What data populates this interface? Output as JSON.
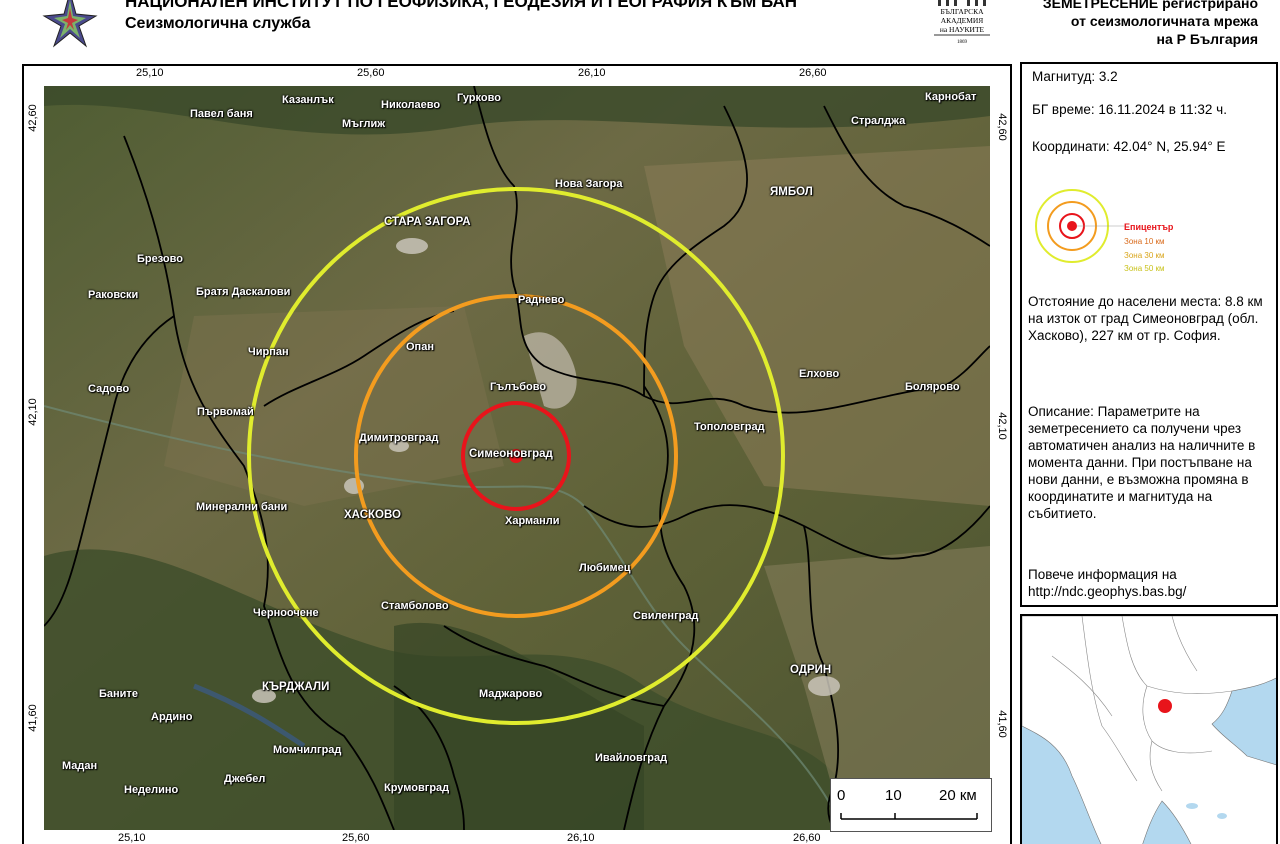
{
  "header": {
    "institute": "НАЦИОНАЛЕН ИНСТИТУТ ПО ГЕОФИЗИКА, ГЕОДЕЗИЯ И ГЕОГРАФИЯ КЪМ БАН",
    "service": "Сеизмологична служба",
    "bas_logo_text": [
      "БЪЛГАРСКА",
      "АКАДЕМИЯ",
      "на НАУКИТЕ",
      "1869"
    ],
    "right_line1": "ЗЕМЕТРЕСЕНИЕ регистрирано",
    "right_line2": "от сеизмологичната мрежа",
    "right_line3": "на Р България"
  },
  "map": {
    "ticks_lon": [
      "25,10",
      "25,60",
      "26,10",
      "26,60"
    ],
    "ticks_lat": [
      "42,60",
      "42,10",
      "41,60"
    ],
    "places": [
      {
        "name": "Казанлък"
      },
      {
        "name": "Николаево"
      },
      {
        "name": "Гурково"
      },
      {
        "name": "Павел баня"
      },
      {
        "name": "Мъглиж"
      },
      {
        "name": "Карнобат"
      },
      {
        "name": "Стралджа"
      },
      {
        "name": "Нова Загора"
      },
      {
        "name": "ЯМБОЛ"
      },
      {
        "name": "СТАРА ЗАГОРА"
      },
      {
        "name": "Брезово"
      },
      {
        "name": "Раковски"
      },
      {
        "name": "Братя Даскалови"
      },
      {
        "name": "Раднево"
      },
      {
        "name": "Опан"
      },
      {
        "name": "Чирпан"
      },
      {
        "name": "Гълъбово"
      },
      {
        "name": "Елхово"
      },
      {
        "name": "Болярово"
      },
      {
        "name": "Садово"
      },
      {
        "name": "Първомай"
      },
      {
        "name": "Тополовград"
      },
      {
        "name": "Димитровград"
      },
      {
        "name": "Симеоновград"
      },
      {
        "name": "Минерални бани"
      },
      {
        "name": "ХАСКОВО"
      },
      {
        "name": "Харманли"
      },
      {
        "name": "Любимец"
      },
      {
        "name": "Черноочене"
      },
      {
        "name": "Стамболово"
      },
      {
        "name": "Свиленград"
      },
      {
        "name": "ОДРИН"
      },
      {
        "name": "КЪРДЖАЛИ"
      },
      {
        "name": "Баните"
      },
      {
        "name": "Маджарово"
      },
      {
        "name": "Ардино"
      },
      {
        "name": "Момчилград"
      },
      {
        "name": "Ивайловград"
      },
      {
        "name": "Мадан"
      },
      {
        "name": "Джебел"
      },
      {
        "name": "Неделино"
      },
      {
        "name": "Крумовград"
      }
    ],
    "zones_km": [
      10,
      30,
      50
    ],
    "zone_colors": [
      "#e8141b",
      "#f39c1f",
      "#e0ec2e"
    ],
    "epicenter_color": "#e8141b",
    "scale": {
      "labels": [
        "0",
        "10",
        "20 км"
      ]
    }
  },
  "info": {
    "magnitude": "Магнитуд: 3.2",
    "time": "БГ време: 16.11.2024 в 11:32 ч.",
    "coords": "Координати: 42.04° N, 25.94° E",
    "legend": {
      "epicenter": "Епицентър",
      "zone10": "Зона 10 км",
      "zone30": "Зона 30 км",
      "zone50": "Зона 50 км"
    },
    "distance": "Отстояние до населени места: 8.8 км на изток от град Симеоновград (обл. Хасково), 227 км от гр. София.",
    "description": "Описание: Параметрите на земетресението са получени чрез автоматичен анализ на наличните в момента данни. При постъпване на нови данни, е възможна промяна в координатите и магнитуда на събитието.",
    "more_info": "Повече информация на",
    "url": "http://ndc.geophys.bas.bg/"
  }
}
